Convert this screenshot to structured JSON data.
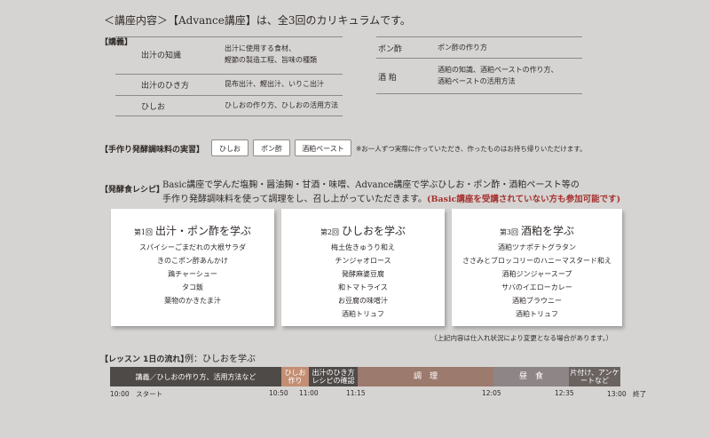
{
  "intro": "＜講座内容＞【Advance講座】は、全3回のカリキュラムです。",
  "lecture": {
    "heading": "【講義】",
    "left": [
      {
        "name": "出汁の知識",
        "desc": [
          "出汁に使用する食材、",
          "鰹節の製造工程、旨味の種類"
        ]
      },
      {
        "name": "出汁のひき方",
        "desc": [
          "昆布出汁、鰹出汁、いりこ出汁"
        ]
      },
      {
        "name": "ひしお",
        "desc": [
          "ひしおの作り方、ひしおの活用方法"
        ]
      }
    ],
    "right": [
      {
        "name": "ポン酢",
        "desc": [
          "ポン酢の作り方"
        ]
      },
      {
        "name": "酒 粕",
        "desc": [
          "酒粕の知識、酒粕ペーストの作り方、",
          "酒粕ペーストの活用方法"
        ]
      }
    ]
  },
  "practice": {
    "heading": "【手作り発酵調味料の実習】",
    "chips": [
      "ひしお",
      "ポン酢",
      "酒粕ペースト"
    ],
    "note": "※お一人ずつ実際に作っていただき、作ったものはお持ち帰りいただけます。"
  },
  "recipe": {
    "heading": "【発酵食レシピ】",
    "line1": "Basic講座で学んだ塩麹・醤油麹・甘酒・味噌、Advance講座で学ぶひしお・ポン酢・酒粕ペースト等の",
    "line2": "手作り発酵調味料を使って調理をし、召し上がっていただきます。",
    "highlight": "(Basic講座を受講されていない方も参加可能です)",
    "highlight_color": "#a5322f"
  },
  "cards": [
    {
      "num": "第1回",
      "title": "出汁・ポン酢を学ぶ",
      "items": [
        "スパイシーごまだれの大根サラダ",
        "きのこポン酢あんかけ",
        "鶏チャーシュー",
        "タコ飯",
        "葉物のかきたま汁"
      ]
    },
    {
      "num": "第2回",
      "title": "ひしおを学ぶ",
      "items": [
        "梅土佐きゅうり和え",
        "チンジャオロース",
        "発酵麻婆豆腐",
        "和トマトライス",
        "お豆腐の味噌汁",
        "酒粕トリュフ"
      ]
    },
    {
      "num": "第3回",
      "title": "酒粕を学ぶ",
      "items": [
        "酒粕ツナポテトグラタン",
        "ささみとブロッコリーのハニーマスタード和え",
        "酒粕ジンジャースープ",
        "サバのイエローカレー",
        "酒粕ブラウニー",
        "酒粕トリュフ"
      ]
    }
  ],
  "cards_note": "（上記内容は仕入れ状況により変更となる場合があります。）",
  "flow": {
    "heading": "【レッスン 1日の流れ】",
    "example": "例：ひしおを学ぶ",
    "segments": [
      {
        "label": "講義／ひしおの作り方、活用方法など",
        "color": "#4e4a48"
      },
      {
        "label": "ひしお作り",
        "color": "#c38e73"
      },
      {
        "label": "出汁のひき方レシピの確認",
        "color": "#4e4a48"
      },
      {
        "label": "調　理",
        "color": "#9c7a6d"
      },
      {
        "label": "昼　食",
        "color": "#8e8587"
      },
      {
        "label": "片付け、アンケートなど",
        "color": "#6a6360"
      }
    ],
    "times": [
      "10:00　スタート",
      "10:50",
      "11:00",
      "11:15",
      "12:05",
      "12:35",
      "13:00　終了"
    ]
  }
}
